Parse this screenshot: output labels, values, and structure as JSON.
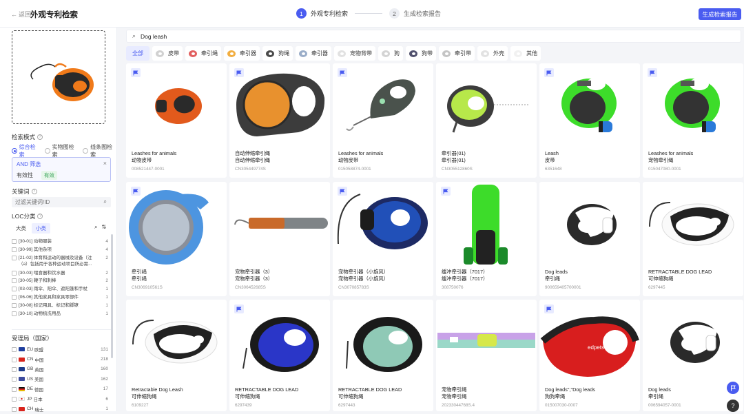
{
  "header": {
    "back": "返回",
    "title": "外观专利检索",
    "steps": [
      {
        "num": "1",
        "label": "外观专利检索"
      },
      {
        "num": "2",
        "label": "生成检索报告"
      }
    ],
    "generate_button": "生成检索报告"
  },
  "sidebar": {
    "search_mode_label": "检索模式",
    "modes": [
      "综合检索",
      "实物图检索",
      "线条图检索"
    ],
    "filter": {
      "title": "AND 筛选",
      "key": "有效性",
      "value": "有效"
    },
    "keyword_label": "关键词",
    "keyword_placeholder": "过滤关键词/ID",
    "loc_label": "LOC分类",
    "loc_tabs": [
      "大类",
      "小类"
    ],
    "loc_items": [
      {
        "text": "[30-01] 动物服装",
        "count": "4"
      },
      {
        "text": "[30-99] 其他杂项",
        "count": "4"
      },
      {
        "text": "[21-02] 体育和运动的器械及设备（注（a）包括用于各种运动项目所必需...",
        "count": "2"
      },
      {
        "text": "[30-03] 喂食器和饮水器",
        "count": "2"
      },
      {
        "text": "[30-05] 鞭子和刺棒",
        "count": "2"
      },
      {
        "text": "[03-03] 雨伞、阳伞、遮阳篷和手杖",
        "count": "1"
      },
      {
        "text": "[06-06] 其他家具和家具零部件",
        "count": "1"
      },
      {
        "text": "[30-08] 标记用具、标记和脚镣",
        "count": "1"
      },
      {
        "text": "[30-10] 动物梳洗用品",
        "count": "1"
      }
    ],
    "authority_label": "受理局（国家）",
    "authorities": [
      {
        "code": "EU",
        "name": "欧盟",
        "count": "131",
        "color": "#1f3e9e"
      },
      {
        "code": "CN",
        "name": "中国",
        "count": "218",
        "color": "#d9241c"
      },
      {
        "code": "GB",
        "name": "英国",
        "count": "160",
        "color": "#1c3a8a"
      },
      {
        "code": "US",
        "name": "美国",
        "count": "162",
        "color": "#3c4a9e"
      },
      {
        "code": "DE",
        "name": "德国",
        "count": "17",
        "color": "#c8a000"
      },
      {
        "code": "JP",
        "name": "日本",
        "count": "6",
        "color": "#ffffff"
      },
      {
        "code": "CH",
        "name": "瑞士",
        "count": "1",
        "color": "#d9241c"
      }
    ]
  },
  "search": {
    "query": "Dog leash"
  },
  "categories": [
    "全部",
    "皮带",
    "牵引绳",
    "牵引器",
    "狗绳",
    "牵引器",
    "宠物背带",
    "狗",
    "狗带",
    "牵引带",
    "外壳",
    "其他"
  ],
  "results": [
    {
      "t1": "Leashes for animals",
      "t2": "动物皮带",
      "id": "008521447-0001",
      "flag": true,
      "img": "orange"
    },
    {
      "t1": "自动伸缩牵引绳",
      "t2": "自动伸缩牵引绳",
      "id": "CN305449774S",
      "flag": true,
      "img": "grayorange"
    },
    {
      "t1": "Leashes for animals",
      "t2": "动物皮带",
      "id": "015058874-0001",
      "flag": true,
      "img": "graygreen"
    },
    {
      "t1": "牵引器(01)",
      "t2": "牵引器(01)",
      "id": "CN305512860S",
      "flag": false,
      "img": "lime"
    },
    {
      "t1": "Leash",
      "t2": "皮带",
      "id": "6351648",
      "flag": true,
      "img": "green"
    },
    {
      "t1": "Leashes for animals",
      "t2": "宠物牵引绳",
      "id": "015047080-0001",
      "flag": true,
      "img": "green"
    },
    {
      "t1": "牵引绳",
      "t2": "牵引绳",
      "id": "CN306910561S",
      "flag": true,
      "img": "blue"
    },
    {
      "t1": "宠物牵引器（3）",
      "t2": "宠物牵引器（3）",
      "id": "CN306452685S",
      "flag": false,
      "img": "stick"
    },
    {
      "t1": "宠物牵引器（小旋风）",
      "t2": "宠物牵引器（小旋风）",
      "id": "CN307085783S",
      "flag": true,
      "img": "navy"
    },
    {
      "t1": "缓冲牵引器（7017）",
      "t2": "缓冲牵引器（7017）",
      "id": "308750076",
      "flag": true,
      "img": "tall"
    },
    {
      "t1": "Dog leads",
      "t2": "牵引绳",
      "id": "900659405700001",
      "flag": false,
      "img": "bw"
    },
    {
      "t1": "RETRACTABLE DOG LEAD",
      "t2": "可伸缩狗绳",
      "id": "6297445",
      "flag": false,
      "img": "bwwhite"
    },
    {
      "t1": "Retractable Dog Leash",
      "t2": "可伸缩狗绳",
      "id": "6109227",
      "flag": false,
      "img": "bwwhite"
    },
    {
      "t1": "RETRACTABLE DOG LEAD",
      "t2": "可伸缩狗绳",
      "id": "6297439",
      "flag": true,
      "img": "royal"
    },
    {
      "t1": "RETRACTABLE DOG LEAD",
      "t2": "可伸缩狗绳",
      "id": "6297443",
      "flag": false,
      "img": "mint"
    },
    {
      "t1": "宠物牵引绳",
      "t2": "宠物牵引绳",
      "id": "20233044768S.4",
      "flag": false,
      "img": "strap"
    },
    {
      "t1": "Dog leads\",\"Dog leads",
      "t2": "狗狗牵绳",
      "id": "015007030-0007",
      "flag": true,
      "img": "red"
    },
    {
      "t1": "Dog leads",
      "t2": "牵引绳",
      "id": "006594057-0001",
      "flag": false,
      "img": "bw"
    }
  ]
}
